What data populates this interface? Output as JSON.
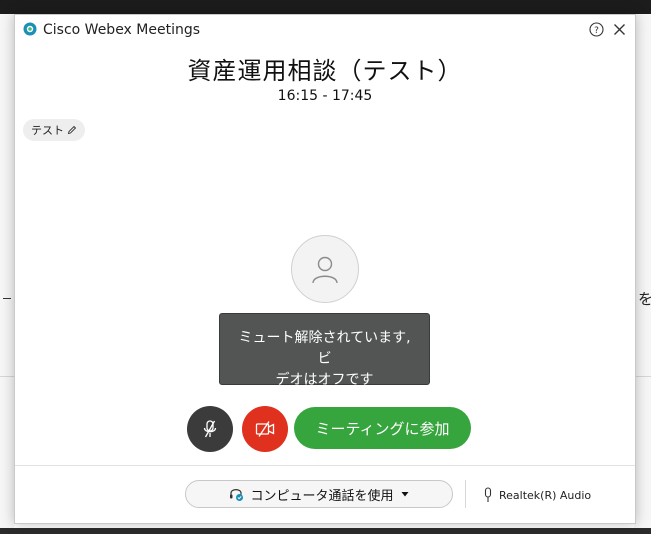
{
  "window": {
    "app_title": "Cisco Webex Meetings"
  },
  "meeting": {
    "title": "資産運用相談（テスト）",
    "time": "16:15 - 17:45",
    "tag": "テスト"
  },
  "tooltip": {
    "line1": "ミュート解除されています, ビ",
    "line2": "デオはオフです"
  },
  "controls": {
    "join_label": "ミーティングに参加"
  },
  "footer": {
    "audio_option": "コンピュータ通話を使用",
    "speaker_device": "Realtek(R) Audio"
  },
  "background": {
    "right_edge_char": "を"
  },
  "colors": {
    "join_green": "#37a53d",
    "video_red": "#e0301e",
    "mute_dark": "#3b3b3b",
    "tooltip_bg": "#535555"
  },
  "icons": [
    "webex-logo-icon",
    "help-icon",
    "close-icon",
    "pencil-icon",
    "person-icon",
    "microphone-muted-icon",
    "video-off-icon",
    "headset-icon",
    "chevron-down-icon",
    "microphone-icon"
  ]
}
